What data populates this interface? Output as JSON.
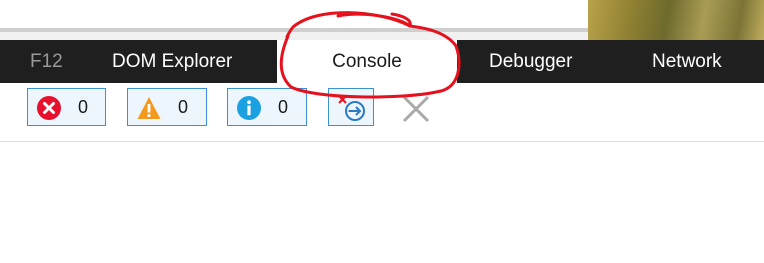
{
  "colors": {
    "tabbar_bg": "#1f1f1f",
    "active_tab_bg": "#ffffff",
    "annotation": "#e5121e",
    "button_border": "#3c90d6",
    "button_fill": "#eef6fd",
    "error": "#e8112d",
    "warning": "#f39a1e",
    "info": "#1ba1e2"
  },
  "tabs": [
    {
      "label": "F12"
    },
    {
      "label": "DOM Explorer"
    },
    {
      "label": "Console",
      "active": true
    },
    {
      "label": "Debugger"
    },
    {
      "label": "Network"
    }
  ],
  "toolbar": {
    "errors": {
      "icon": "error-icon",
      "count": "0"
    },
    "warnings": {
      "icon": "warning-icon",
      "count": "0"
    },
    "messages": {
      "icon": "info-icon",
      "count": "0"
    },
    "clear_on_navigate": {
      "icon": "clear-on-navigate-icon"
    },
    "clear": {
      "icon": "clear-x-icon"
    }
  }
}
